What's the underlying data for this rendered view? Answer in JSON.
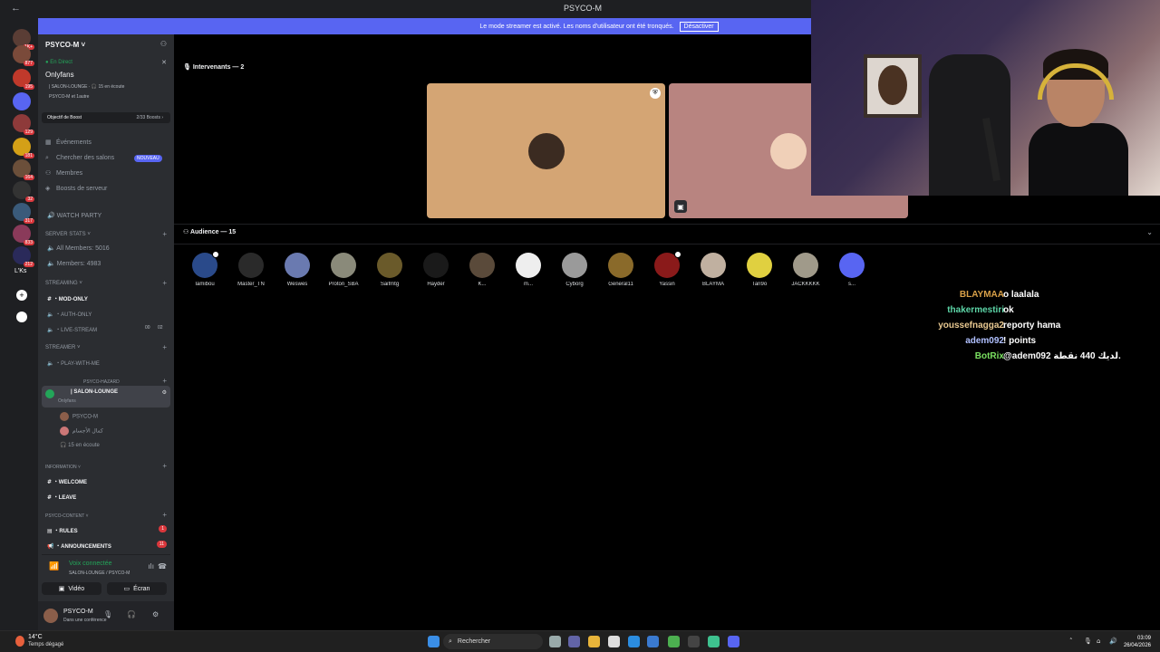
{
  "window": {
    "title": "PSYCO-M",
    "back_label": "←"
  },
  "banner": {
    "text": "Le mode streamer est activé. Les noms d'utilisateur ont été tronqués.",
    "button": "Désactiver"
  },
  "servers": [
    {
      "name": "server-1",
      "badge": "1K+",
      "color": "#5a3d35"
    },
    {
      "name": "server-2",
      "badge": "877",
      "color": "#7a4a3a"
    },
    {
      "name": "server-3",
      "badge": "195",
      "color": "#c0392b"
    },
    {
      "name": "server-4",
      "badge": "",
      "color": "#5865f2"
    },
    {
      "name": "server-5",
      "badge": "129",
      "color": "#8e3a3a"
    },
    {
      "name": "server-6",
      "badge": "181",
      "color": "#d4a017"
    },
    {
      "name": "server-7",
      "badge": "164",
      "color": "#6b4f3a"
    },
    {
      "name": "server-8",
      "badge": "32",
      "color": "#333"
    },
    {
      "name": "server-9",
      "badge": "317",
      "color": "#3a5a7a"
    },
    {
      "name": "server-10",
      "badge": "833",
      "color": "#8a3a5a"
    },
    {
      "name": "server-11",
      "badge": "212",
      "color": "#2a2a5a"
    }
  ],
  "server_labels": {
    "lks": "L'Ks"
  },
  "sidebar": {
    "server_name": "PSYCO-M ˅",
    "live": {
      "status": "● En Direct",
      "title": "Onlyfans",
      "channel_line": "| SALON-LOUNGE · 🎧 15 en écoute",
      "viewers_line": "PSYCO-M et 1autre"
    },
    "boost": {
      "label": "Objectif de Boost",
      "progress": "2/33 Boosts ›"
    },
    "nav": [
      {
        "label": "Événements",
        "icon": "calendar-icon"
      },
      {
        "label": "Chercher des salons",
        "icon": "search-icon"
      },
      {
        "label": "Membres",
        "icon": "members-icon"
      },
      {
        "label": "Boosts de serveur",
        "icon": "boost-icon"
      }
    ],
    "new_pill": "NOUVEAU",
    "watch_party": "WATCH PARTY",
    "server_stats": {
      "header": "SERVER STATS",
      "all_members": "All Members: 5016",
      "members": "Members: 4983"
    },
    "streaming": {
      "header": "STREAMING",
      "channels": [
        "・MOD-ONLY",
        "・AUTH-ONLY",
        "・LIVE-STREAM"
      ],
      "live_counts": [
        "00",
        "02"
      ]
    },
    "streamer": {
      "header": "STREAMER",
      "channels": [
        "・PLAY-WITH-ME"
      ]
    },
    "hazard_header": "PSYCO-HAZARD",
    "lounge": {
      "name": "| SALON-LOUNGE",
      "sub": "Onlyfans",
      "users": [
        "PSYCO-M",
        "كمال الأجسام"
      ],
      "listening": "15 en écoute"
    },
    "information": {
      "header": "INFORMATION",
      "channels": [
        "・WELCOME",
        "・LEAVE"
      ]
    },
    "content": {
      "header": "PSYCO-CONTENT",
      "channels": [
        "・RULES",
        "・ANNOUNCEMENTS"
      ],
      "badges": [
        "1",
        "11"
      ]
    },
    "voice": {
      "status": "Voix connectée",
      "location": "SALON-LOUNGE / PSYCO-M",
      "video_btn": "Vidéo",
      "screen_btn": "Écran"
    },
    "user": {
      "name": "PSYCO-M",
      "status": "Dans une conférence"
    }
  },
  "stage": {
    "speakers_title": "Intervenants — 2",
    "audience_title": "Audience — 15",
    "tiles": [
      {
        "name": "speaker-1",
        "bg": "#d4a574"
      },
      {
        "name": "speaker-2",
        "bg": "#b88480"
      }
    ],
    "audience": [
      {
        "name": "Iamibou",
        "color": "#2a4a8a"
      },
      {
        "name": "Master_TN",
        "color": "#2a2a2a"
      },
      {
        "name": "Weswes",
        "color": "#6a7ab0"
      },
      {
        "name": "Proton_SBA",
        "color": "#8a8a7a"
      },
      {
        "name": "Saifmtg",
        "color": "#6a5a2a"
      },
      {
        "name": "Hayder",
        "color": "#1a1a1a"
      },
      {
        "name": "K...",
        "color": "#5a4a3a"
      },
      {
        "name": "m...",
        "color": "#eeeeee"
      },
      {
        "name": "Cyborg",
        "color": "#9a9a9a"
      },
      {
        "name": "General11",
        "color": "#8a6a2a"
      },
      {
        "name": "Yassin",
        "color": "#8a1a1a"
      },
      {
        "name": "BLAYMA",
        "color": "#c0b0a0"
      },
      {
        "name": "Tari9o",
        "color": "#e0d040"
      },
      {
        "name": "JACKKKKK",
        "color": "#a09a8a"
      },
      {
        "name": "s...",
        "color": "#5865f2"
      }
    ]
  },
  "chat": [
    {
      "user": "BLAYMAA",
      "text": "o laalala",
      "color": "#d8a048"
    },
    {
      "user": "thakermestiri",
      "text": "ok",
      "color": "#5dd6a8"
    },
    {
      "user": "youssefnagga2",
      "text": "reporty hama",
      "color": "#e8c890"
    },
    {
      "user": "adem092",
      "text": "! points",
      "color": "#b0c0ff"
    },
    {
      "user": "BotRix",
      "text": "@adem092 لديك 440 نقطة.",
      "color": "#7ae060"
    }
  ],
  "taskbar": {
    "temp": "14°C",
    "weather": "Temps dégagé",
    "search": "Rechercher",
    "time": "03:09",
    "date": "26/04/2026"
  }
}
